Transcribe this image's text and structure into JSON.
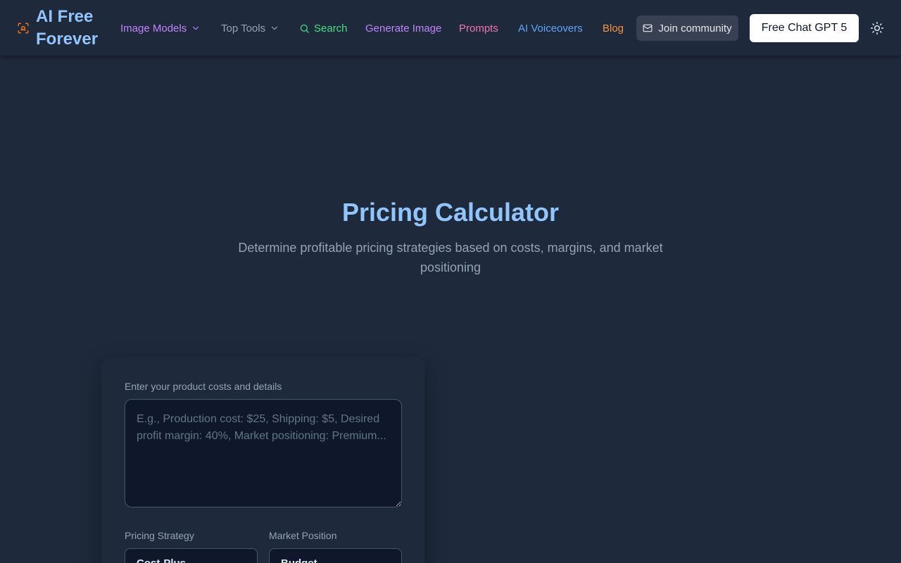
{
  "header": {
    "logo_text": "AI Free Forever",
    "nav": {
      "image_models": "Image Models",
      "top_tools": "Top Tools",
      "search": "Search",
      "generate_image": "Generate Image",
      "prompts": "Prompts",
      "ai_voiceovers": "AI Voiceovers",
      "blog": "Blog"
    },
    "join_community": "Join community",
    "free_chat": "Free Chat GPT 5",
    "icons": {
      "logo": "scan-face-icon",
      "dropdown": "chevron-down-icon",
      "search": "search-icon",
      "mail": "mail-icon",
      "theme": "sun-icon"
    }
  },
  "hero": {
    "title": "Pricing Calculator",
    "subtitle": "Determine profitable pricing strategies based on costs, margins, and market positioning"
  },
  "form": {
    "details_label": "Enter your product costs and details",
    "details_placeholder": "E.g., Production cost: $25, Shipping: $5, Desired profit margin: 40%, Market positioning: Premium...",
    "strategy_label": "Pricing Strategy",
    "strategy_value": "Cost-Plus",
    "position_label": "Market Position",
    "position_value": "Budget"
  },
  "colors": {
    "background": "#1e293b",
    "accent_blue": "#93c5fd",
    "purple": "#c084fc",
    "green": "#4ade80",
    "pink": "#f472b6",
    "blue": "#60a5fa",
    "orange": "#fb923c"
  }
}
